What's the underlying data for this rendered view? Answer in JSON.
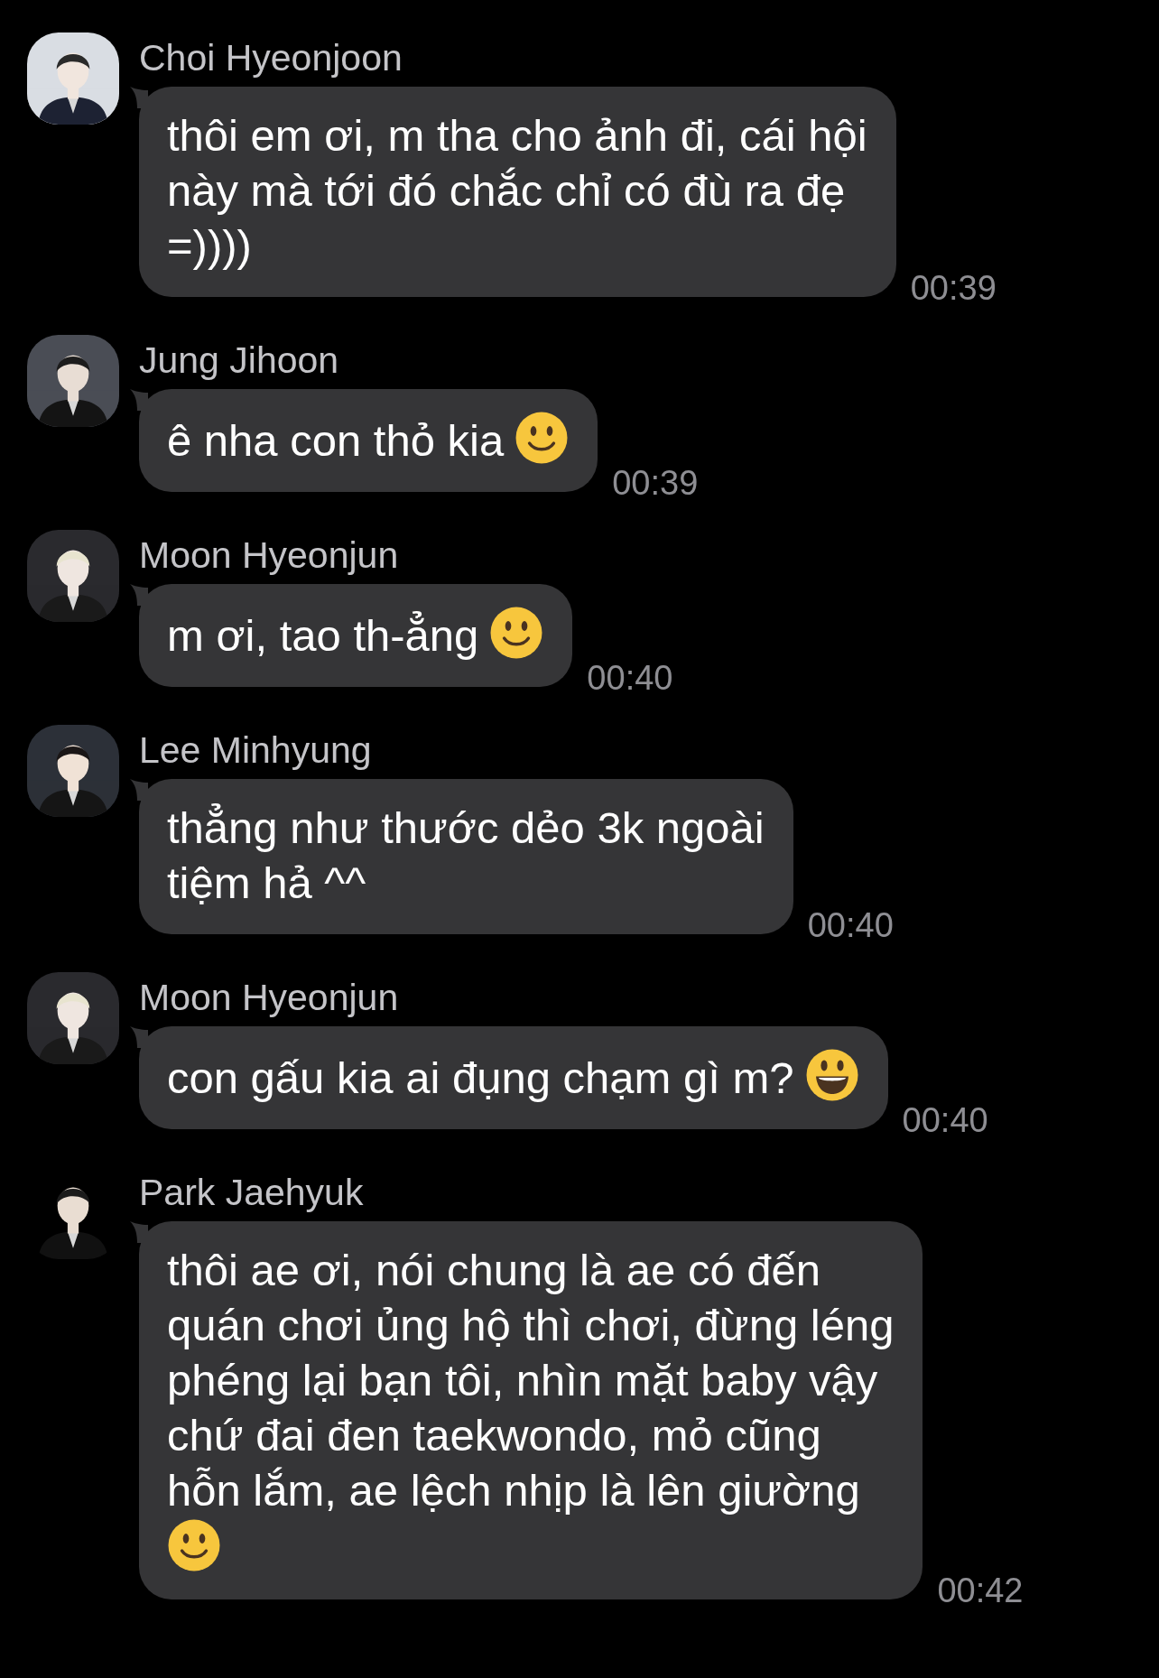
{
  "messages": [
    {
      "sender": "Choi Hyeonjoon",
      "avatar": {
        "kind": "picture"
      },
      "lines": [
        "thôi em ơi, m tha cho ảnh đi, cái hội",
        "này mà tới đó chắc chỉ có đù ra đẹ",
        "=))))"
      ],
      "time": "00:39"
    },
    {
      "sender": "Jung Jihoon",
      "avatar": {
        "kind": "picture"
      },
      "lines": [
        "ê nha con thỏ kia"
      ],
      "emoji": {
        "kind": "slight_smile"
      },
      "time": "00:39"
    },
    {
      "sender": "Moon Hyeonjun",
      "avatar": {
        "kind": "picture"
      },
      "lines": [
        "m ơi, tao th-ẳng"
      ],
      "emoji": {
        "kind": "slight_smile"
      },
      "time": "00:40"
    },
    {
      "sender": "Lee Minhyung",
      "avatar": {
        "kind": "picture"
      },
      "lines": [
        "thẳng như thước dẻo 3k ngoài",
        "tiệm hả ^^"
      ],
      "time": "00:40"
    },
    {
      "sender": "Moon Hyeonjun",
      "avatar": {
        "kind": "picture"
      },
      "lines": [
        "con gấu kia ai đụng chạm gì m?"
      ],
      "emoji": {
        "kind": "grin"
      },
      "time": "00:40"
    },
    {
      "sender": "Park Jaehyuk",
      "avatar": {
        "kind": "picture"
      },
      "lines": [
        "thôi ae ơi, nói chung là ae có đến",
        "quán chơi ủng hộ thì chơi, đừng léng",
        "phéng lại bạn tôi, nhìn mặt baby vậy",
        "chứ đai đen taekwondo, mỏ cũng",
        "hỗn lắm, ae lệch nhịp là lên giường"
      ],
      "emoji": {
        "kind": "slight_smile",
        "own_line": true
      },
      "time": "00:42"
    }
  ]
}
